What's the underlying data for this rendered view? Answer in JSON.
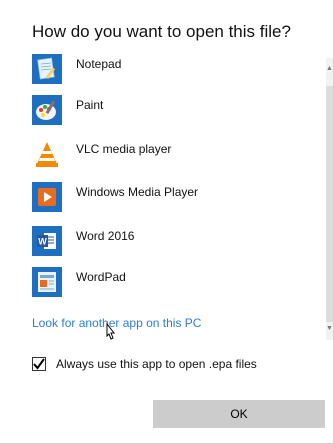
{
  "dialog": {
    "title": "How do you want to open this file?",
    "apps": [
      {
        "label": "Notepad",
        "icon": "notepad-icon"
      },
      {
        "label": "Paint",
        "icon": "paint-icon"
      },
      {
        "label": "VLC media player",
        "icon": "vlc-icon"
      },
      {
        "label": "Windows Media Player",
        "icon": "windows-media-player-icon"
      },
      {
        "label": "Word 2016",
        "icon": "word-icon"
      },
      {
        "label": "WordPad",
        "icon": "wordpad-icon"
      }
    ],
    "look_link": "Look for another app on this PC",
    "always_use": {
      "label": "Always use this app to open .epa files",
      "checked": true
    },
    "ok_label": "OK"
  },
  "colors": {
    "link": "#2f7ec8",
    "ok_button": "#cccccc",
    "icon_blue": "#1e6fbf",
    "vlc_orange": "#f08a00",
    "wmp_orange": "#e96b1e",
    "word_blue": "#2b579a"
  },
  "scrollbar": {
    "up_arrow": "▲",
    "down_arrow": "▼"
  }
}
